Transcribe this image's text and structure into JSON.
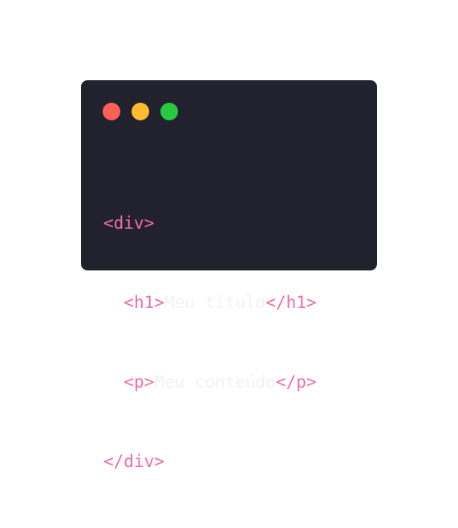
{
  "colors": {
    "background": "#ffffff",
    "card": "#22222e",
    "tag": "#f06daa",
    "text": "#f2f2f2",
    "dot_close": "#fe5f57",
    "dot_minimize": "#febc2e",
    "dot_maximize": "#28c840"
  },
  "window_controls": [
    {
      "name": "close",
      "icon": "red-circle"
    },
    {
      "name": "minimize",
      "icon": "yellow-circle"
    },
    {
      "name": "maximize",
      "icon": "green-circle"
    }
  ],
  "code": {
    "line1_open": "<div>",
    "line2_open": "<h1>",
    "line2_text": "Meu título",
    "line2_close": "</h1>",
    "line3_open": "<p>",
    "line3_text": "Meu conteúdo",
    "line3_close": "</p>",
    "line4_close": "</div>"
  }
}
